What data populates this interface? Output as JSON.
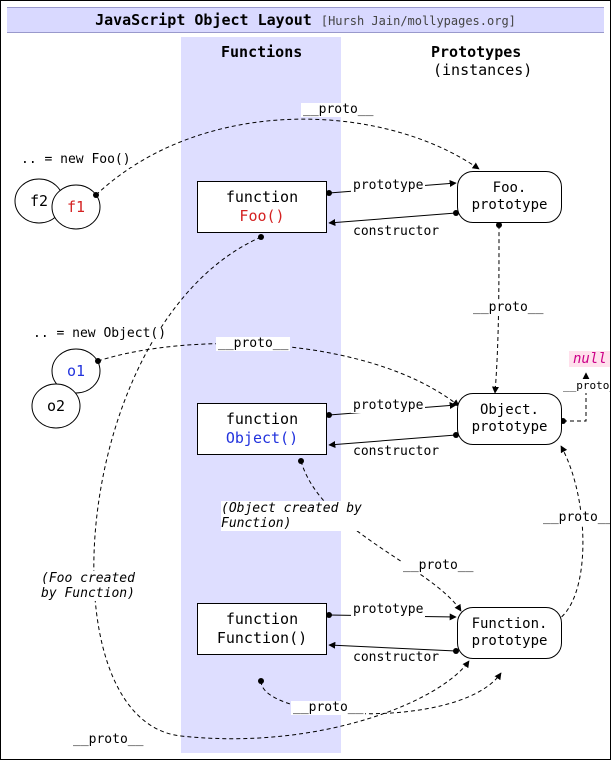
{
  "header": {
    "title_bold": "JavaScript Object Layout",
    "attrib": "[Hursh Jain/mollypages.org]"
  },
  "columns": {
    "functions": "Functions",
    "prototypes": "Prototypes",
    "prototypes_sub": "(instances)"
  },
  "instances": {
    "foo_new": ".. = new Foo()",
    "f1": "f1",
    "f2": "f2",
    "obj_new": ".. = new Object()",
    "o1": "o1",
    "o2": "o2"
  },
  "functions": {
    "kw": "function",
    "foo": "Foo()",
    "object": "Object()",
    "function": "Function()"
  },
  "prototypes": {
    "foo": {
      "l1": "Foo.",
      "l2": "prototype"
    },
    "object": {
      "l1": "Object.",
      "l2": "prototype"
    },
    "function": {
      "l1": "Function.",
      "l2": "prototype"
    }
  },
  "null": "null",
  "edge_labels": {
    "proto": "__proto__",
    "prototype": "prototype",
    "constructor": "constructor"
  },
  "notes": {
    "obj_created": "(Object created by\nFunction)",
    "foo_created": "(Foo created\nby Function)"
  }
}
